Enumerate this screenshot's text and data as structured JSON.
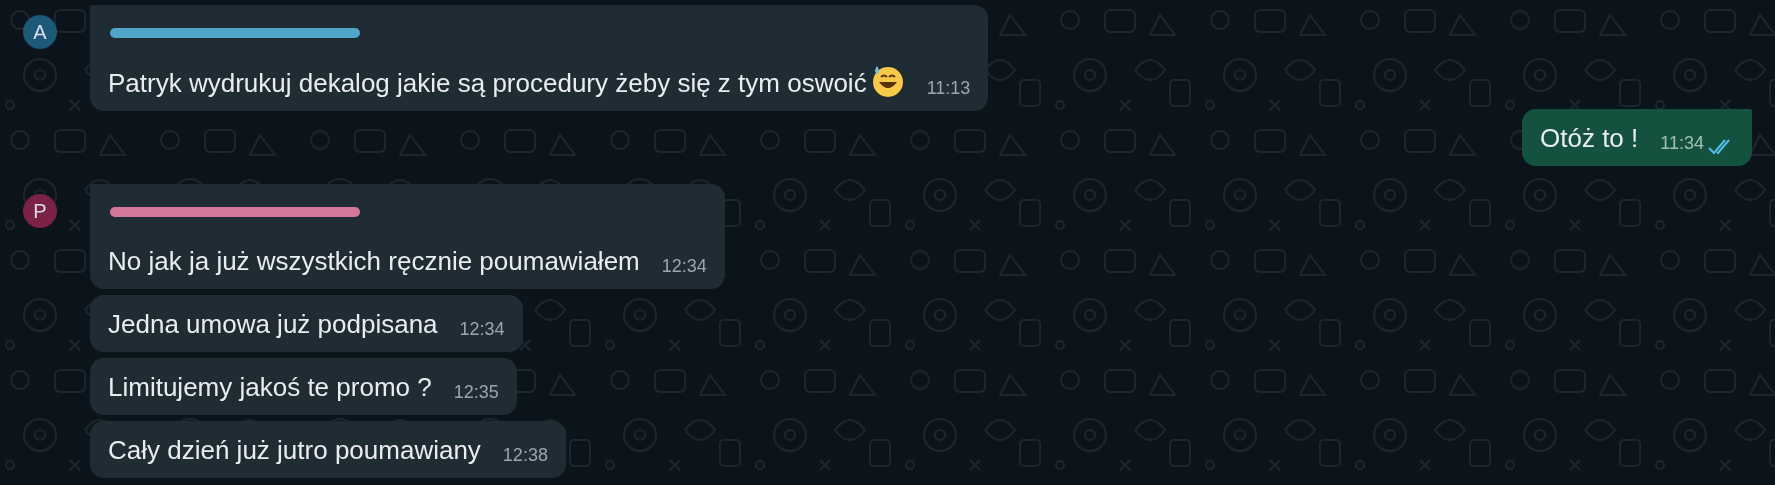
{
  "groups": [
    {
      "kind": "incoming",
      "avatar": "A",
      "color": "#1d5a79",
      "name_redaction": {
        "color": "#4fa6c9"
      },
      "messages": [
        {
          "text": "Patryk wydrukuj dekalog jakie są procedury żeby się z tym oswoić",
          "time": "11:13",
          "emoji": true
        }
      ]
    },
    {
      "kind": "outgoing",
      "messages": [
        {
          "text": "Otóż to !",
          "time": "11:34",
          "read": true
        }
      ]
    },
    {
      "kind": "incoming",
      "avatar": "P",
      "color": "#7b2346",
      "name_redaction": {
        "color": "#d2789a"
      },
      "messages": [
        {
          "text": "No jak ja już wszystkich ręcznie poumawiałem",
          "time": "12:34"
        },
        {
          "text": "Jedna umowa już podpisana",
          "time": "12:34"
        },
        {
          "text": "Limitujemy jakoś te promo ?",
          "time": "12:35"
        },
        {
          "text": "Cały dzień już jutro poumawiany",
          "time": "12:38"
        }
      ]
    }
  ]
}
